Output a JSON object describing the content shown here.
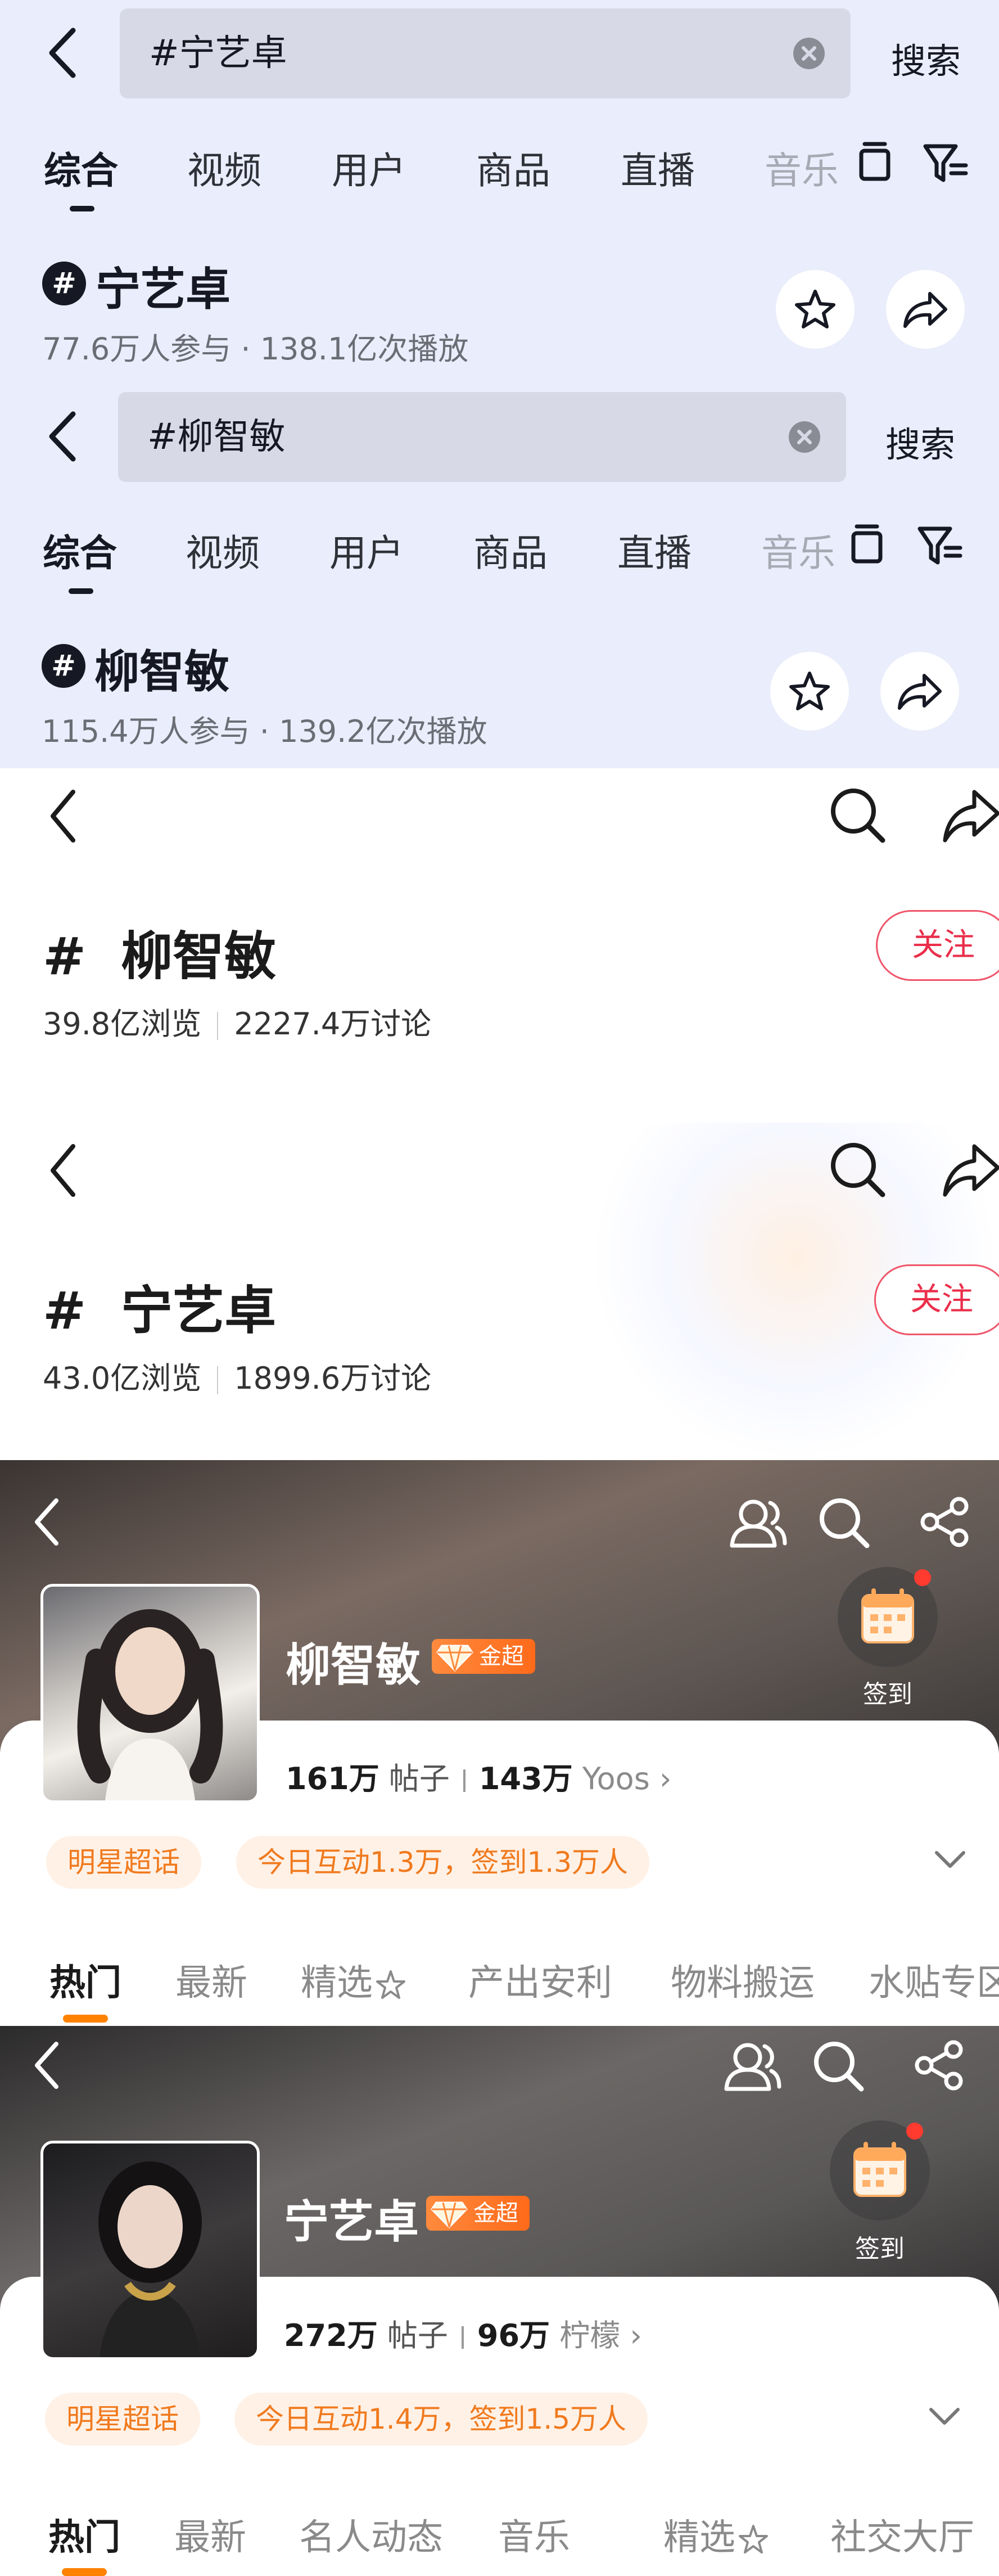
{
  "douyin_ningyizhuo": {
    "search_value": "#宁艺卓",
    "search_button": "搜索",
    "tabs": [
      "综合",
      "视频",
      "用户",
      "商品",
      "直播",
      "音乐"
    ],
    "topic_title": "宁艺卓",
    "topic_stats": "77.6万人参与 · 138.1亿次播放"
  },
  "douyin_liuzhimin": {
    "search_value": "#柳智敏",
    "search_button": "搜索",
    "tabs": [
      "综合",
      "视频",
      "用户",
      "商品",
      "直播",
      "音乐"
    ],
    "topic_title": "柳智敏",
    "topic_stats": "115.4万人参与 · 139.2亿次播放"
  },
  "weibo_topic_liuzhimin": {
    "hash": "#",
    "title": "柳智敏",
    "views": "39.8亿浏览",
    "discussions": "2227.4万讨论",
    "follow_label": "关注"
  },
  "weibo_topic_ningyizhuo": {
    "hash": "#",
    "title": "宁艺卓",
    "views": "43.0亿浏览",
    "discussions": "1899.6万讨论",
    "follow_label": "关注"
  },
  "supertopic_liuzhimin": {
    "name": "柳智敏",
    "badge": "金超",
    "checkin_label": "签到",
    "posts_count": "161万",
    "posts_label": "帖子",
    "fans_count": "143万",
    "fans_label": "Yoos",
    "tag_primary": "明星超话",
    "tag_activity": "今日互动1.3万，签到1.3万人",
    "tabs": [
      "热门",
      "最新",
      "精选",
      "产出安利",
      "物料搬运",
      "水贴专区"
    ]
  },
  "supertopic_ningyizhuo": {
    "name": "宁艺卓",
    "badge": "金超",
    "checkin_label": "签到",
    "posts_count": "272万",
    "posts_label": "帖子",
    "fans_count": "96万",
    "fans_label": "柠檬",
    "tag_primary": "明星超话",
    "tag_activity": "今日互动1.4万，签到1.5万人",
    "tabs": [
      "热门",
      "最新",
      "名人动态",
      "音乐",
      "精选",
      "社交大厅"
    ]
  },
  "colors": {
    "douyin_bg": "#eaedfb",
    "weibo_follow": "#ea2e4a",
    "supertopic_accent": "#ff8200",
    "tag_orange": "#f07a1e"
  },
  "icons": [
    "back-icon",
    "clear-icon",
    "filter-icon",
    "layout-icon",
    "star-icon",
    "share-icon",
    "search-icon",
    "people-icon",
    "calendar-icon",
    "chevron-down-icon",
    "flower-icon"
  ]
}
